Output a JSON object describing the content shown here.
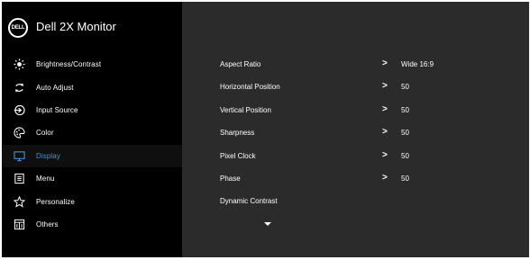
{
  "header": {
    "logo_text": "DELL",
    "title": "Dell 2X Monitor"
  },
  "sidebar": {
    "items": [
      {
        "label": "Brightness/Contrast",
        "icon": "brightness-icon"
      },
      {
        "label": "Auto Adjust",
        "icon": "auto-adjust-icon"
      },
      {
        "label": "Input Source",
        "icon": "input-source-icon"
      },
      {
        "label": "Color",
        "icon": "color-palette-icon"
      },
      {
        "label": "Display",
        "icon": "display-monitor-icon",
        "active": true
      },
      {
        "label": "Menu",
        "icon": "menu-icon"
      },
      {
        "label": "Personalize",
        "icon": "star-icon"
      },
      {
        "label": "Others",
        "icon": "others-icon"
      }
    ]
  },
  "display": {
    "rows": [
      {
        "name": "Aspect Ratio",
        "chevron": ">",
        "value": "Wide 16:9"
      },
      {
        "name": "Horizontal Position",
        "chevron": ">",
        "value": "50"
      },
      {
        "name": "Vertical Position",
        "chevron": ">",
        "value": "50"
      },
      {
        "name": "Sharpness",
        "chevron": ">",
        "value": "50"
      },
      {
        "name": "Pixel Clock",
        "chevron": ">",
        "value": "50"
      },
      {
        "name": "Phase",
        "chevron": ">",
        "value": "50"
      },
      {
        "name": "Dynamic Contrast",
        "chevron": "",
        "value": ""
      }
    ]
  },
  "colors": {
    "background": "#2b2b2b",
    "sidebar": "#000000",
    "accent": "#4a90d9",
    "text": "#ffffff"
  }
}
